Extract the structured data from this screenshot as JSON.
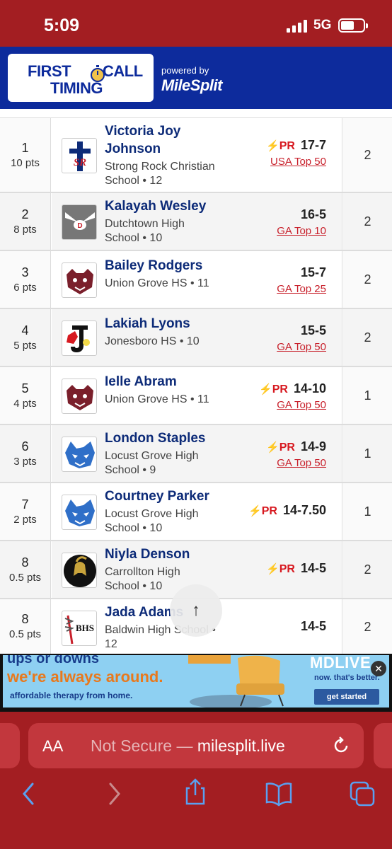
{
  "status_bar": {
    "time": "5:09",
    "network": "5G"
  },
  "header": {
    "logo_word_first": "FIRST",
    "logo_word_call": "CALL",
    "logo_line2": "TIMING",
    "powered_by": "powered by",
    "brand": "MileSplit"
  },
  "results": [
    {
      "place": "1",
      "points": "10 pts",
      "name": "Victoria Joy Johnson",
      "school": "Strong Rock Christian School • 12",
      "pr": "PR",
      "mark": "17-7",
      "ranking": "USA Top 50",
      "heats": "2",
      "logo": "SR"
    },
    {
      "place": "2",
      "points": "8 pts",
      "name": "Kalayah Wesley",
      "school": "Dutchtown High School • 10",
      "pr": "",
      "mark": "16-5",
      "ranking": "GA Top 10",
      "heats": "2",
      "logo": "D"
    },
    {
      "place": "3",
      "points": "6 pts",
      "name": "Bailey Rodgers",
      "school": "Union Grove HS • 11",
      "pr": "",
      "mark": "15-7",
      "ranking": "GA Top 25",
      "heats": "2",
      "logo": "wolverine"
    },
    {
      "place": "4",
      "points": "5 pts",
      "name": "Lakiah Lyons",
      "school": "Jonesboro HS • 10",
      "pr": "",
      "mark": "15-5",
      "ranking": "GA Top 50",
      "heats": "2",
      "logo": "J"
    },
    {
      "place": "5",
      "points": "4 pts",
      "name": "Ielle Abram",
      "school": "Union Grove HS • 11",
      "pr": "PR",
      "mark": "14-10",
      "ranking": "GA Top 50",
      "heats": "1",
      "logo": "wolverine"
    },
    {
      "place": "6",
      "points": "3 pts",
      "name": "London Staples",
      "school": "Locust Grove High School • 9",
      "pr": "PR",
      "mark": "14-9",
      "ranking": "GA Top 50",
      "heats": "1",
      "logo": "wildcat"
    },
    {
      "place": "7",
      "points": "2 pts",
      "name": "Courtney Parker",
      "school": "Locust Grove High School • 10",
      "pr": "PR",
      "mark": "14-7.50",
      "ranking": "",
      "heats": "1",
      "logo": "wildcat"
    },
    {
      "place": "8",
      "points": "0.5 pts",
      "name": "Niyla Denson",
      "school": "Carrollton High School • 10",
      "pr": "PR",
      "mark": "14-5",
      "ranking": "",
      "heats": "2",
      "logo": "trojan"
    },
    {
      "place": "8",
      "points": "0.5 pts",
      "name": "Jada Adams",
      "school": "Baldwin High School • 12",
      "pr": "",
      "mark": "14-5",
      "ranking": "",
      "heats": "2",
      "logo": "BHS"
    }
  ],
  "scroll_top_icon": "arrow-up",
  "ad": {
    "line1": "ups or downs",
    "line2": "we're always around.",
    "line3": "affordable therapy from home.",
    "brand": "MDLIVE",
    "tagline": "now. that's better.",
    "cta": "get started"
  },
  "browser": {
    "aa": "AA",
    "not_secure": "Not Secure —",
    "domain": "milesplit.live"
  },
  "colors": {
    "brand_blue": "#0d2b9c",
    "browser_red": "#a31e22",
    "pr_red": "#d71920",
    "name_navy": "#0d2b78"
  }
}
